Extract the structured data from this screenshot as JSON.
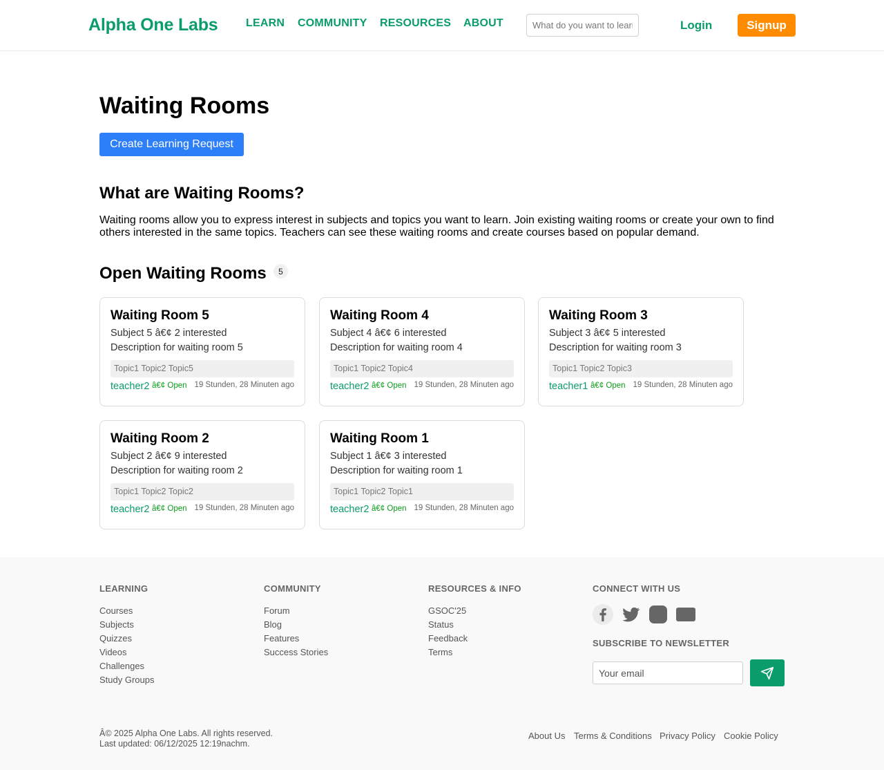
{
  "header": {
    "logo": "Alpha One Labs",
    "nav": [
      "LEARN",
      "COMMUNITY",
      "RESOURCES",
      "ABOUT"
    ],
    "search_placeholder": "What do you want to learn?",
    "login": "Login",
    "signup": "Signup"
  },
  "main": {
    "title": "Waiting Rooms",
    "create_button": "Create Learning Request",
    "what_heading": "What are Waiting Rooms?",
    "intro": "Waiting rooms allow you to express interest in subjects and topics you want to learn. Join existing waiting rooms or create your own to find others interested in the same topics. Teachers can see these waiting rooms and create courses based on popular demand.",
    "open_heading": "Open Waiting Rooms",
    "open_count": "5"
  },
  "rooms": [
    {
      "title": "Waiting Room 5",
      "subject": "Subject 5 â€¢ 2 interested",
      "description": "Description for waiting room 5",
      "topics": "Topic1 Topic2 Topic5",
      "teacher": "teacher2",
      "status": "â€¢ Open",
      "time": "19 Stunden, 28 Minuten ago"
    },
    {
      "title": "Waiting Room 4",
      "subject": "Subject 4 â€¢ 6 interested",
      "description": "Description for waiting room 4",
      "topics": "Topic1 Topic2 Topic4",
      "teacher": "teacher2",
      "status": "â€¢ Open",
      "time": "19 Stunden, 28 Minuten ago"
    },
    {
      "title": "Waiting Room 3",
      "subject": "Subject 3 â€¢ 5 interested",
      "description": "Description for waiting room 3",
      "topics": "Topic1 Topic2 Topic3",
      "teacher": "teacher1",
      "status": "â€¢ Open",
      "time": "19 Stunden, 28 Minuten ago"
    },
    {
      "title": "Waiting Room 2",
      "subject": "Subject 2 â€¢ 9 interested",
      "description": "Description for waiting room 2",
      "topics": "Topic1 Topic2 Topic2",
      "teacher": "teacher2",
      "status": "â€¢ Open",
      "time": "19 Stunden, 28 Minuten ago"
    },
    {
      "title": "Waiting Room 1",
      "subject": "Subject 1 â€¢ 3 interested",
      "description": "Description for waiting room 1",
      "topics": "Topic1 Topic2 Topic1",
      "teacher": "teacher2",
      "status": "â€¢ Open",
      "time": "19 Stunden, 28 Minuten ago"
    }
  ],
  "footer": {
    "learning": {
      "heading": "LEARNING",
      "links": [
        "Courses",
        "Subjects",
        "Quizzes",
        "Videos",
        "Challenges",
        "Study Groups"
      ]
    },
    "community": {
      "heading": "COMMUNITY",
      "links": [
        "Forum",
        "Blog",
        "Features",
        "Success Stories"
      ]
    },
    "resources": {
      "heading": "RESOURCES & INFO",
      "links": [
        "GSOC'25",
        "Status",
        "Feedback",
        "Terms"
      ]
    },
    "connect": {
      "heading": "CONNECT WITH US",
      "icons": [
        "facebook-icon",
        "twitter-icon",
        "instagram-icon",
        "email-icon"
      ]
    },
    "newsletter": {
      "heading": "SUBSCRIBE TO NEWSLETTER",
      "placeholder": "Your email"
    },
    "copyright": "Â© 2025 Alpha One Labs. All rights reserved.",
    "updated": "Last updated: 06/12/2025 12:19nachm.",
    "bottom_links": [
      "About Us",
      "Terms & Conditions",
      "Privacy Policy",
      "Cookie Policy"
    ]
  },
  "colors": {
    "brand_green": "#0a9c6a",
    "signup_orange": "#ff8c00",
    "primary_blue": "#2d7ff9"
  }
}
